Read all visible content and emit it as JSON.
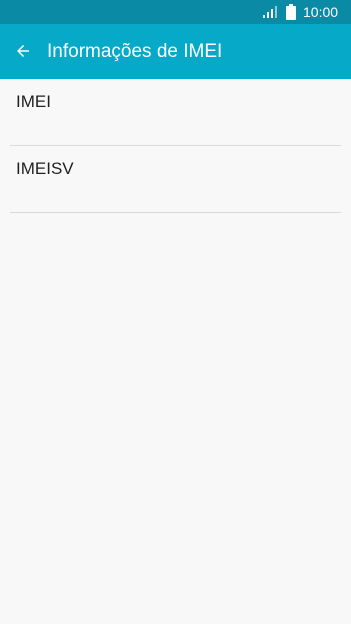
{
  "status_bar": {
    "time": "10:00",
    "icons": [
      "signal-icon",
      "battery-icon"
    ]
  },
  "app_bar": {
    "title": "Informações de IMEI",
    "back_icon": "back-arrow-icon"
  },
  "list": {
    "items": [
      {
        "label": "IMEI"
      },
      {
        "label": "IMEISV"
      }
    ]
  },
  "colors": {
    "status_bar": "#0b8aa6",
    "app_bar": "#06a9c8",
    "background": "#f8f8f8",
    "divider": "#dadada",
    "text_primary": "#1f1f1f",
    "text_on_primary": "#ffffff"
  }
}
